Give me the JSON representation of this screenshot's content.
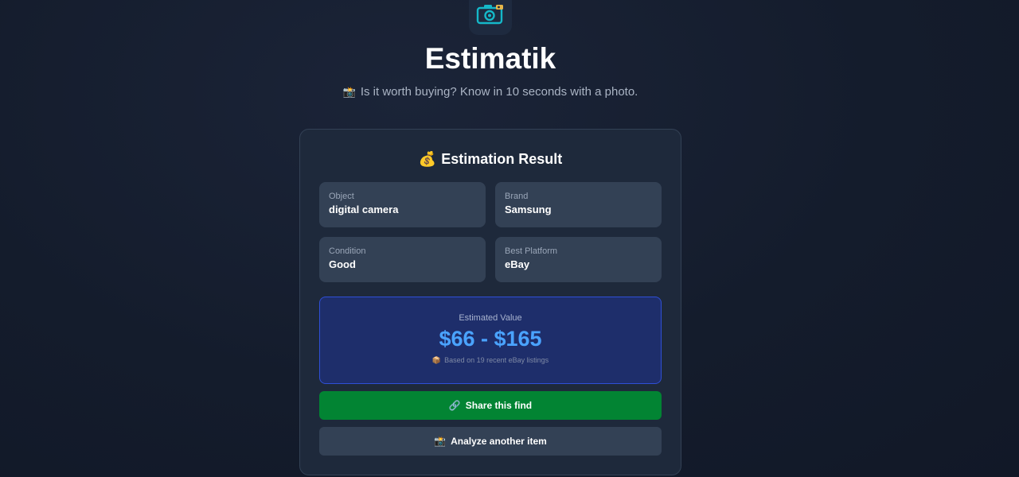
{
  "app": {
    "title": "Estimatik",
    "tagline": "Is it worth buying? Know in 10 seconds with a photo.",
    "tagline_emoji": "📸",
    "logo_icon": "camera-icon"
  },
  "result": {
    "heading": "Estimation Result",
    "heading_emoji": "💰",
    "fields": {
      "object": {
        "label": "Object",
        "value": "digital camera"
      },
      "brand": {
        "label": "Brand",
        "value": "Samsung"
      },
      "condition": {
        "label": "Condition",
        "value": "Good"
      },
      "platform": {
        "label": "Best Platform",
        "value": "eBay"
      }
    },
    "estimate": {
      "label": "Estimated Value",
      "value": "$66 - $165",
      "note": "Based on 19 recent eBay listings",
      "note_emoji": "📦"
    },
    "actions": {
      "share_label": "Share this find",
      "share_emoji": "🔗",
      "again_label": "Analyze another item",
      "again_emoji": "📸"
    }
  },
  "colors": {
    "background": "#141c2c",
    "card": "#1e293b",
    "field": "#334155",
    "accent_blue": "#4aa3ff",
    "share_green": "#028433"
  }
}
